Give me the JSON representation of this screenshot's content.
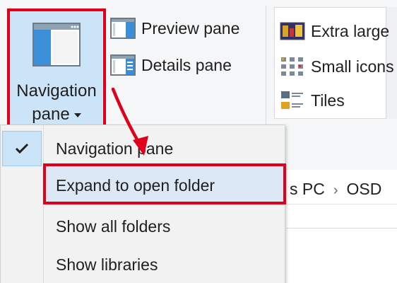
{
  "ribbon": {
    "nav_pane_button": {
      "line1": "Navigation",
      "line2": "pane"
    },
    "preview_pane": "Preview pane",
    "details_pane": "Details pane",
    "layout": {
      "extra_large": "Extra large",
      "small_icons": "Small icons",
      "tiles": "Tiles"
    }
  },
  "address": {
    "segments": [
      "s PC",
      "OSD"
    ]
  },
  "menu": {
    "items": [
      {
        "label": "Navigation pane",
        "checked": true
      },
      {
        "label": "Expand to open folder",
        "checked": false
      },
      {
        "label": "Show all folders",
        "checked": false
      },
      {
        "label": "Show libraries",
        "checked": false
      }
    ]
  },
  "colors": {
    "annotation_red": "#e0001b",
    "selected_blue": "#cce4f7",
    "menu_bg": "#f2f2f2"
  }
}
